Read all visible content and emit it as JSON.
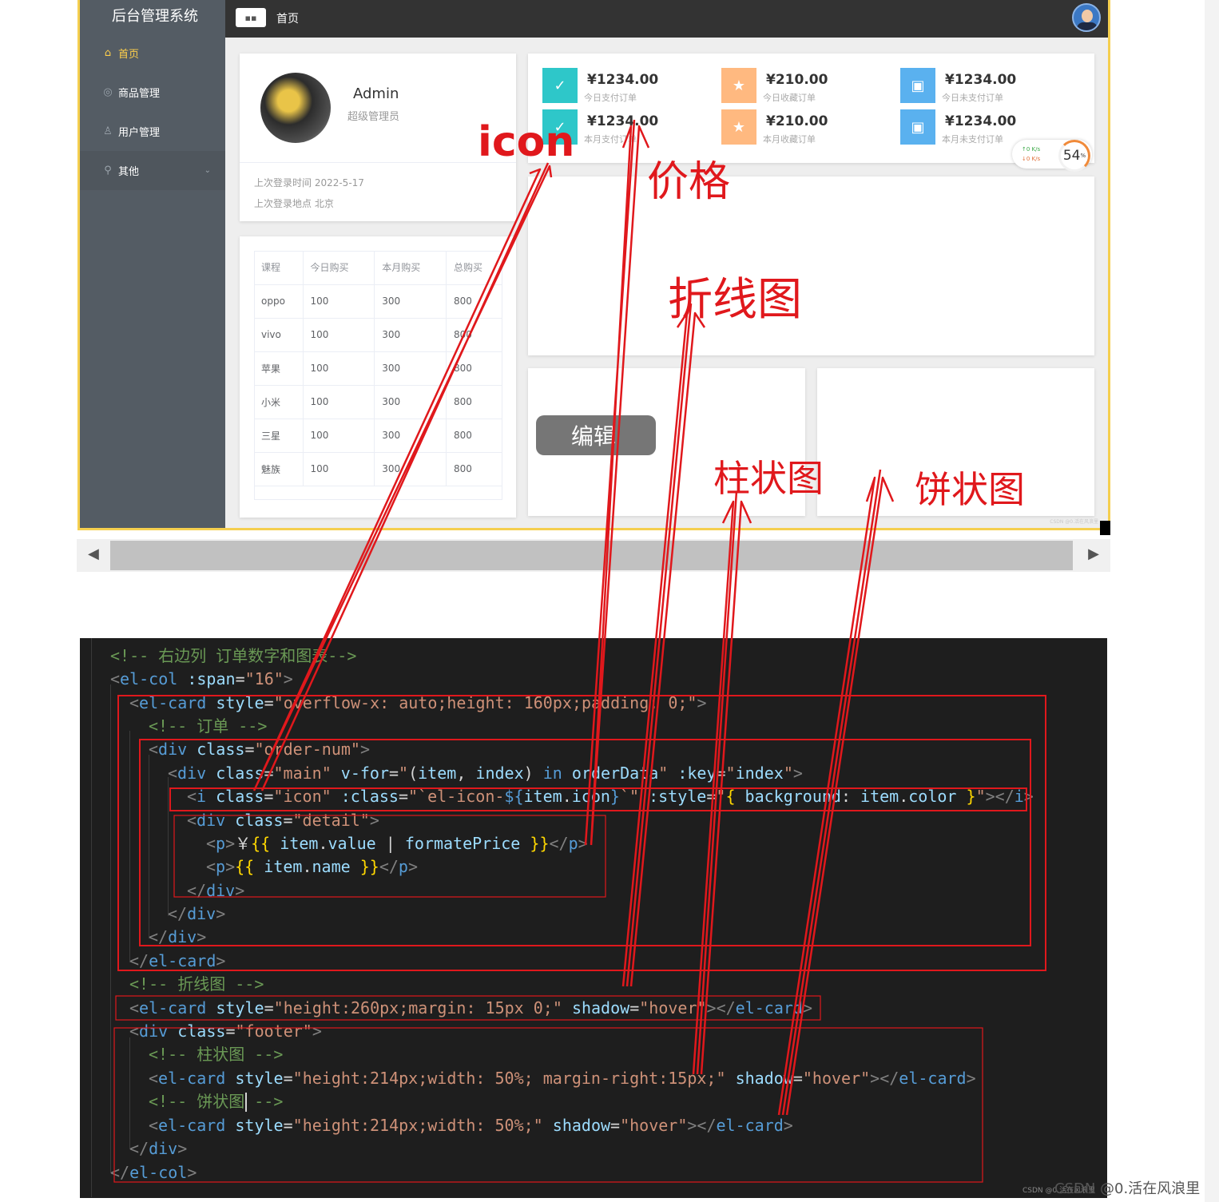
{
  "sidebar": {
    "title": "后台管理系统",
    "items": [
      {
        "label": "首页",
        "icon": "home-icon",
        "glyph": "⌂",
        "active": true
      },
      {
        "label": "商品管理",
        "icon": "video-play-icon",
        "glyph": "◎"
      },
      {
        "label": "用户管理",
        "icon": "user-icon",
        "glyph": "♙"
      },
      {
        "label": "其他",
        "icon": "location-icon",
        "glyph": "⚲",
        "chevron": "⌄"
      }
    ]
  },
  "header": {
    "toggle_glyph": "▪▪",
    "breadcrumb": "首页"
  },
  "user_card": {
    "name": "Admin",
    "role": "超级管理员",
    "last_login_time": "上次登录时间 2022-5-17",
    "last_login_place": "上次登录地点 北京"
  },
  "table": {
    "headers": [
      "课程",
      "今日购买",
      "本月购买",
      "总购买"
    ],
    "rows": [
      [
        "oppo",
        "100",
        "300",
        "800"
      ],
      [
        "vivo",
        "100",
        "300",
        "800"
      ],
      [
        "苹果",
        "100",
        "300",
        "800"
      ],
      [
        "小米",
        "100",
        "300",
        "800"
      ],
      [
        "三星",
        "100",
        "300",
        "800"
      ],
      [
        "魅族",
        "100",
        "300",
        "800"
      ]
    ]
  },
  "orders": [
    {
      "price": "¥1234.00",
      "name": "今日支付订单",
      "icon": "success-icon",
      "glyph": "✓",
      "color": "#2ec7c9"
    },
    {
      "price": "¥210.00",
      "name": "今日收藏订单",
      "icon": "star-icon",
      "glyph": "★",
      "color": "#ffb980"
    },
    {
      "price": "¥1234.00",
      "name": "今日未支付订单",
      "icon": "goods-icon",
      "glyph": "▣",
      "color": "#5ab1ef"
    },
    {
      "price": "¥1234.00",
      "name": "本月支付订单",
      "icon": "success-icon",
      "glyph": "✓",
      "color": "#2ec7c9"
    },
    {
      "price": "¥210.00",
      "name": "本月收藏订单",
      "icon": "star-icon",
      "glyph": "★",
      "color": "#ffb980"
    },
    {
      "price": "¥1234.00",
      "name": "本月未支付订单",
      "icon": "goods-icon",
      "glyph": "▣",
      "color": "#5ab1ef"
    }
  ],
  "speed_widget": {
    "up": "↑0  K/s",
    "down": "↓0  K/s",
    "percent": "54",
    "percent_unit": "%"
  },
  "edit_button": "编辑",
  "tiny_watermark": "CSDN @0.活在风浪里",
  "annotations": {
    "icon": "icon",
    "price": "价格",
    "line_chart": "折线图",
    "bar_chart": "柱状图",
    "pie_chart": "饼状图"
  },
  "code": {
    "comment_right_col": "<!-- 右边列 订单数字和图表-->",
    "comment_order": "<!-- 订单 -->",
    "comment_line": "<!-- 折线图 -->",
    "comment_bar": "<!-- 柱状图 -->",
    "comment_pie_pre": "<!-- 饼状图",
    "comment_pie_post": " -->"
  },
  "footer": {
    "watermark": "CSDN @0.活在风浪里",
    "small": "CSDN @0.活在风浪里"
  },
  "colors": {
    "accent_yellow": "#ffd04b",
    "sidebar": "#545c64",
    "annotation_red": "#e0181c"
  }
}
